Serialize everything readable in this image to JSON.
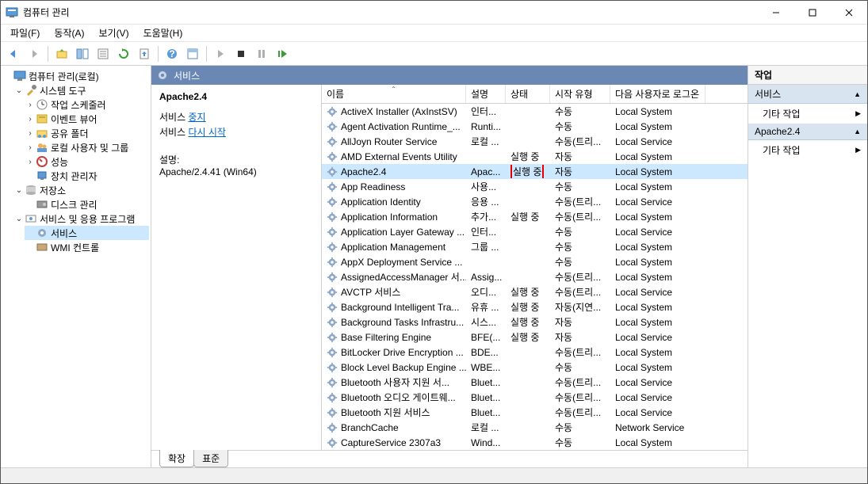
{
  "window": {
    "title": "컴퓨터 관리"
  },
  "menus": {
    "file": "파일(F)",
    "action": "동작(A)",
    "view": "보기(V)",
    "help": "도움말(H)"
  },
  "tree": {
    "root": "컴퓨터 관리(로컬)",
    "system_tools": "시스템 도구",
    "task_scheduler": "작업 스케줄러",
    "event_viewer": "이벤트 뷰어",
    "shared_folders": "공유 폴더",
    "local_users_groups": "로컬 사용자 및 그룹",
    "performance": "성능",
    "device_manager": "장치 관리자",
    "storage": "저장소",
    "disk_management": "디스크 관리",
    "services_apps": "서비스 및 응용 프로그램",
    "services": "서비스",
    "wmi_control": "WMI 컨트롤"
  },
  "center": {
    "header": "서비스",
    "selected_name": "Apache2.4",
    "svc_stop_prefix": "서비스 ",
    "svc_stop_link": "중지",
    "svc_restart_prefix": "서비스 ",
    "svc_restart_link": "다시 시작",
    "desc_label": "설명:",
    "desc_value": "Apache/2.4.41 (Win64)"
  },
  "columns": {
    "name": "이름",
    "desc": "설명",
    "status": "상태",
    "startup": "시작 유형",
    "logon": "다음 사용자로 로그온"
  },
  "services": [
    {
      "name": "ActiveX Installer (AxInstSV)",
      "desc": "인터...",
      "status": "",
      "startup": "수동",
      "logon": "Local System"
    },
    {
      "name": "Agent Activation Runtime_...",
      "desc": "Runti...",
      "status": "",
      "startup": "수동",
      "logon": "Local System"
    },
    {
      "name": "AllJoyn Router Service",
      "desc": "로컬 ...",
      "status": "",
      "startup": "수동(트리...",
      "logon": "Local Service"
    },
    {
      "name": "AMD External Events Utility",
      "desc": "",
      "status": "실행 중",
      "startup": "자동",
      "logon": "Local System"
    },
    {
      "name": "Apache2.4",
      "desc": "Apac...",
      "status": "실행 중",
      "startup": "자동",
      "logon": "Local System",
      "selected": true,
      "highlightStatus": true
    },
    {
      "name": "App Readiness",
      "desc": "사용...",
      "status": "",
      "startup": "수동",
      "logon": "Local System"
    },
    {
      "name": "Application Identity",
      "desc": "응용 ...",
      "status": "",
      "startup": "수동(트리...",
      "logon": "Local Service"
    },
    {
      "name": "Application Information",
      "desc": "추가...",
      "status": "실행 중",
      "startup": "수동(트리...",
      "logon": "Local System"
    },
    {
      "name": "Application Layer Gateway ...",
      "desc": "인터...",
      "status": "",
      "startup": "수동",
      "logon": "Local Service"
    },
    {
      "name": "Application Management",
      "desc": "그룹 ...",
      "status": "",
      "startup": "수동",
      "logon": "Local System"
    },
    {
      "name": "AppX Deployment Service ...",
      "desc": "",
      "status": "",
      "startup": "수동",
      "logon": "Local System"
    },
    {
      "name": "AssignedAccessManager 서...",
      "desc": "Assig...",
      "status": "",
      "startup": "수동(트리...",
      "logon": "Local System"
    },
    {
      "name": "AVCTP 서비스",
      "desc": "오디...",
      "status": "실행 중",
      "startup": "수동(트리...",
      "logon": "Local Service"
    },
    {
      "name": "Background Intelligent Tra...",
      "desc": "유휴 ...",
      "status": "실행 중",
      "startup": "자동(지연...",
      "logon": "Local System"
    },
    {
      "name": "Background Tasks Infrastru...",
      "desc": "시스...",
      "status": "실행 중",
      "startup": "자동",
      "logon": "Local System"
    },
    {
      "name": "Base Filtering Engine",
      "desc": "BFE(...",
      "status": "실행 중",
      "startup": "자동",
      "logon": "Local Service"
    },
    {
      "name": "BitLocker Drive Encryption ...",
      "desc": "BDE...",
      "status": "",
      "startup": "수동(트리...",
      "logon": "Local System"
    },
    {
      "name": "Block Level Backup Engine ...",
      "desc": "WBE...",
      "status": "",
      "startup": "수동",
      "logon": "Local System"
    },
    {
      "name": "Bluetooth 사용자 지원 서...",
      "desc": "Bluet...",
      "status": "",
      "startup": "수동(트리...",
      "logon": "Local Service"
    },
    {
      "name": "Bluetooth 오디오 게이트웨...",
      "desc": "Bluet...",
      "status": "",
      "startup": "수동(트리...",
      "logon": "Local Service"
    },
    {
      "name": "Bluetooth 지원 서비스",
      "desc": "Bluet...",
      "status": "",
      "startup": "수동(트리...",
      "logon": "Local Service"
    },
    {
      "name": "BranchCache",
      "desc": "로컬 ...",
      "status": "",
      "startup": "수동",
      "logon": "Network Service"
    },
    {
      "name": "CaptureService 2307a3",
      "desc": "Wind...",
      "status": "",
      "startup": "수동",
      "logon": "Local System"
    }
  ],
  "tabs": {
    "extended": "확장",
    "standard": "표준"
  },
  "actions": {
    "header": "작업",
    "section_services": "서비스",
    "more_actions": "기타 작업",
    "section_selected": "Apache2.4"
  }
}
